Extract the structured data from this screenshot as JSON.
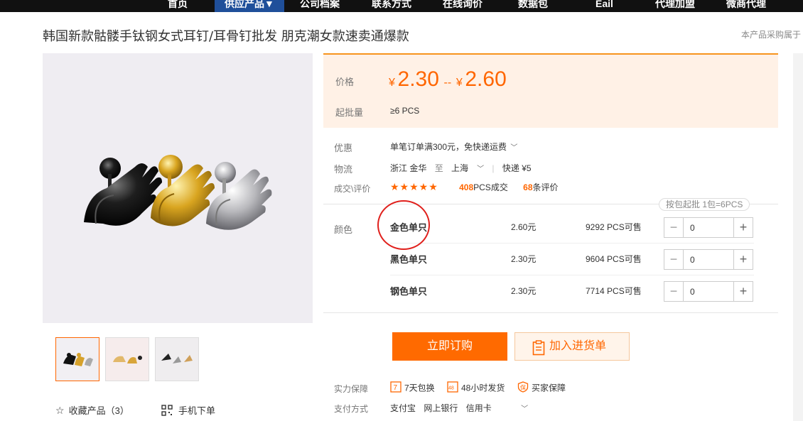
{
  "nav": {
    "items": [
      "首页",
      "供应产品",
      "公司档案",
      "联系方式",
      "在线询价",
      "数据包",
      "Eail",
      "代理加盟",
      "微商代理"
    ],
    "active_arrow": "▼"
  },
  "product": {
    "title": "韩国新款骷髅手钛钢女式耳钉/耳骨钉批发 朋克潮女款速卖通爆款",
    "notice": "本产品采购属于"
  },
  "price": {
    "label": "价格",
    "currency": "¥",
    "low": "2.30",
    "separator": "--",
    "high": "2.60",
    "min_label": "起批量",
    "min_qty": "≥6 PCS"
  },
  "offers": {
    "discount_label": "优惠",
    "discount_text": "单笔订单满300元，免快递运费",
    "logistics_label": "物流",
    "origin": "浙江 金华",
    "to": "至",
    "destination": "上海",
    "express": "快递 ¥5",
    "deals_label": "成交\\评价",
    "stars": "★★★★★",
    "deals_count": "408",
    "deals_suffix": "PCS成交",
    "reviews_count": "68",
    "reviews_suffix": "条评价"
  },
  "variants": {
    "label": "颜色",
    "pack_badge": "按包起批 1包=6PCS",
    "rows": [
      {
        "name": "金色单只",
        "price": "2.60元",
        "stock": "9292 PCS可售",
        "qty": "0"
      },
      {
        "name": "黑色单只",
        "price": "2.30元",
        "stock": "9604 PCS可售",
        "qty": "0"
      },
      {
        "name": "钢色单只",
        "price": "2.30元",
        "stock": "7714 PCS可售",
        "qty": "0"
      }
    ]
  },
  "actions": {
    "buy_label": "立即订购",
    "cart_label": "加入进货单"
  },
  "guarantee": {
    "label": "实力保障",
    "items": [
      "7天包换",
      "48小时发货",
      "买家保障"
    ],
    "pay_label": "支付方式",
    "pay_methods": [
      "支付宝",
      "网上银行",
      "信用卡"
    ]
  },
  "sidebar": {
    "fav_label": "收藏产品（3）",
    "mobile_label": "手机下单"
  },
  "colors": {
    "accent": "#ff6a00",
    "nav_bg": "#111111",
    "nav_active": "#1f4f9a",
    "price_bg": "#fff1e6",
    "annotation_circle": "#e0201c"
  }
}
